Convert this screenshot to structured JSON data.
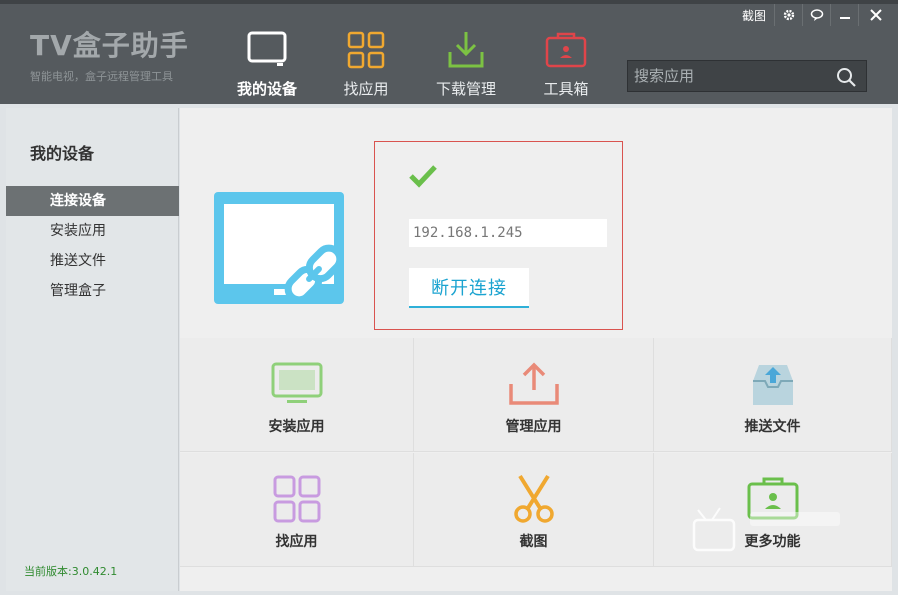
{
  "app": {
    "logo_title": "TV盒子助手",
    "logo_subtitle": "智能电视，盒子远程管理工具"
  },
  "window_controls": {
    "screenshot": "截图"
  },
  "nav": [
    {
      "label": "我的设备",
      "icon": "tv-icon"
    },
    {
      "label": "找应用",
      "icon": "grid-icon"
    },
    {
      "label": "下载管理",
      "icon": "download-icon"
    },
    {
      "label": "工具箱",
      "icon": "toolbox-icon"
    }
  ],
  "search": {
    "placeholder": "搜索应用"
  },
  "sidebar": {
    "title": "我的设备",
    "items": [
      "连接设备",
      "安装应用",
      "推送文件",
      "管理盒子"
    ],
    "version": "当前版本:3.0.42.1"
  },
  "connection": {
    "ip": "192.168.1.245",
    "disconnect_label": "断开连接"
  },
  "tiles": [
    {
      "label": "安装应用",
      "icon": "tv-install-icon"
    },
    {
      "label": "管理应用",
      "icon": "upload-icon"
    },
    {
      "label": "推送文件",
      "icon": "inbox-upload-icon"
    },
    {
      "label": "找应用",
      "icon": "grid-icon"
    },
    {
      "label": "截图",
      "icon": "scissors-icon"
    },
    {
      "label": "更多功能",
      "icon": "toolbox-icon"
    }
  ],
  "colors": {
    "header_bg": "#555a5e",
    "accent_blue": "#1aa3d0",
    "device_blue": "#5cc6ec",
    "check_green": "#6abf4b",
    "border_red": "#d9534f",
    "version_green": "#2f8a2f"
  }
}
